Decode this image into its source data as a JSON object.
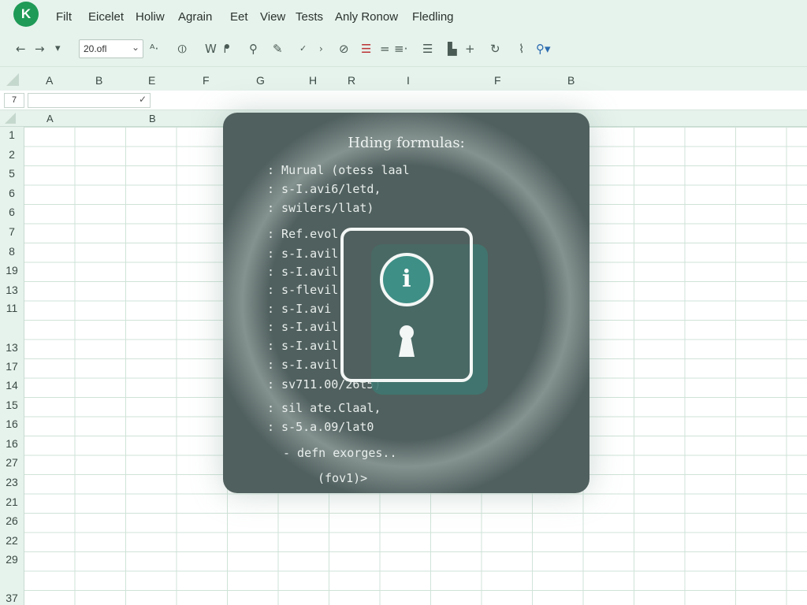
{
  "app": {
    "logo_letter": "K",
    "menu": [
      "Filt",
      "Eicelet",
      "Holiw",
      "Agrain",
      "Eet",
      "View",
      "Tests",
      "Anly Ronow",
      "Fledling"
    ]
  },
  "toolbar": {
    "zoom_value": "20.ofl",
    "icons": [
      "back-arrow-icon",
      "forward-arrow-icon",
      "dropdown-icon",
      "sort-icon",
      "link-icon",
      "word-icon",
      "wifi-icon",
      "search-icon",
      "pencil-icon",
      "check-icon",
      "arrow-icon",
      "paint-icon",
      "border-icon",
      "equals-icon",
      "align-icon",
      "list-icon",
      "chart-icon",
      "plus-icon",
      "refresh-icon",
      "cursor-icon",
      "user-icon"
    ]
  },
  "column_headers_top": [
    "A",
    "B",
    "E",
    "F",
    "G",
    "H",
    "R",
    "I",
    "F",
    "B"
  ],
  "formula_bar": {
    "name_box": "7",
    "value": ""
  },
  "column_headers_grid": [
    "A",
    "B"
  ],
  "row_numbers": [
    "1",
    "2",
    "5",
    "6",
    "6",
    "7",
    "8",
    "19",
    "13",
    "11",
    "13",
    "17",
    "14",
    "15",
    "16",
    "16",
    "27",
    "23",
    "21",
    "26",
    "22",
    "29",
    "37"
  ],
  "overlay": {
    "title": "Hding formulas:",
    "lines": [
      ": Murual (otess laal",
      ": s-I.avi6/letd,",
      ": swilers/llat)",
      ": Ref.evol",
      ": s-I.avil",
      ": s-I.avil",
      ": s-flevil",
      ": s-I.avi",
      ": s-I.avil",
      ": s-I.avil",
      ": s-I.avil",
      ": sv711.00/26t5)",
      ": sil ate.Claal,",
      ": s-5.a.09/lat0",
      "- defn exorges..",
      "(fov1)>"
    ],
    "info_symbol": "i"
  }
}
